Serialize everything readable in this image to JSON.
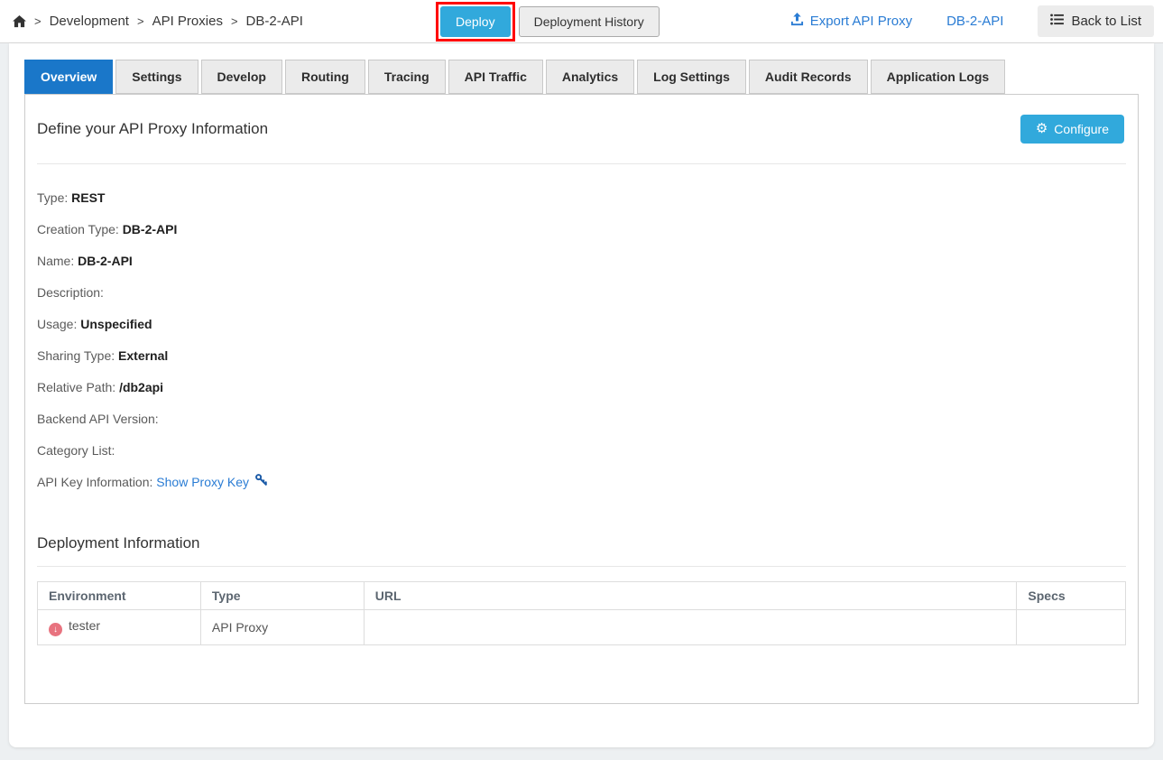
{
  "topbar": {
    "breadcrumb": {
      "items": [
        "Development",
        "API Proxies",
        "DB-2-API"
      ],
      "separator": ">"
    },
    "deploy_button": "Deploy",
    "deployment_history_button": "Deployment History",
    "export_link": "Export API Proxy",
    "proxy_link": "DB-2-API",
    "back_to_list_button": "Back to List"
  },
  "tabs": [
    {
      "label": "Overview",
      "active": true
    },
    {
      "label": "Settings",
      "active": false
    },
    {
      "label": "Develop",
      "active": false
    },
    {
      "label": "Routing",
      "active": false
    },
    {
      "label": "Tracing",
      "active": false
    },
    {
      "label": "API Traffic",
      "active": false
    },
    {
      "label": "Analytics",
      "active": false
    },
    {
      "label": "Log Settings",
      "active": false
    },
    {
      "label": "Audit Records",
      "active": false
    },
    {
      "label": "Application Logs",
      "active": false
    }
  ],
  "overview": {
    "section_title": "Define your API Proxy Information",
    "configure_button": "Configure",
    "fields": [
      {
        "label": "Type:",
        "value": "REST"
      },
      {
        "label": "Creation Type:",
        "value": "DB-2-API"
      },
      {
        "label": "Name:",
        "value": "DB-2-API"
      },
      {
        "label": "Description:",
        "value": ""
      },
      {
        "label": "Usage:",
        "value": "Unspecified"
      },
      {
        "label": "Sharing Type:",
        "value": "External"
      },
      {
        "label": "Relative Path:",
        "value": "/db2api"
      },
      {
        "label": "Backend API Version:",
        "value": ""
      },
      {
        "label": "Category List:",
        "value": ""
      },
      {
        "label": "API Key Information:",
        "link": "Show Proxy Key",
        "icon": "key-icon"
      }
    ]
  },
  "deployment": {
    "section_title": "Deployment Information",
    "table": {
      "headers": [
        "Environment",
        "Type",
        "URL",
        "Specs"
      ],
      "rows": [
        {
          "environment": "tester",
          "status_icon": "undeployed-icon",
          "type": "API Proxy",
          "url": "",
          "specs": ""
        }
      ]
    }
  },
  "colors": {
    "accent": "#31a9dc",
    "tab-active": "#1a77c9",
    "link": "#2a7cd4",
    "status-red": "#e8737f",
    "annotation": "#ff0000",
    "key": "#1d5ca8"
  }
}
